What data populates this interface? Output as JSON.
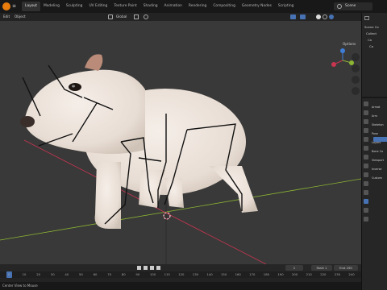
{
  "workspace_tabs": [
    "Layout",
    "Modeling",
    "Sculpting",
    "UV Editing",
    "Texture Paint",
    "Shading",
    "Animation",
    "Rendering",
    "Compositing",
    "Geometry Nodes",
    "Scripting"
  ],
  "active_tab_index": 0,
  "scene_label": "Scene",
  "header": {
    "mode": "Edit",
    "object": "Object",
    "orientation": "Global",
    "options": "Options"
  },
  "outliner": {
    "items": [
      "Scene Co",
      "Collect",
      "Ca",
      "Ca"
    ]
  },
  "properties": {
    "labels": [
      "Armat",
      "Arm",
      "Skeleton",
      "Pose",
      "Layers",
      "Bone Co",
      "Viewport",
      "Inverse",
      "Custom"
    ]
  },
  "timeline": {
    "current_frame": "1",
    "start_label": "Start",
    "start_value": "1",
    "end_label": "End",
    "end_value": "250",
    "ticks": [
      "0",
      "10",
      "20",
      "30",
      "40",
      "50",
      "60",
      "70",
      "80",
      "90",
      "100",
      "110",
      "120",
      "130",
      "140",
      "150",
      "160",
      "170",
      "180",
      "190",
      "200",
      "210",
      "220",
      "230",
      "240"
    ]
  },
  "status_text": "Center View to Mouse",
  "colors": {
    "accent": "#4772b3",
    "x_axis": "#c83550",
    "y_axis": "#8bb532",
    "z_axis": "#3f7ed8",
    "playhead": "#4772b3"
  }
}
